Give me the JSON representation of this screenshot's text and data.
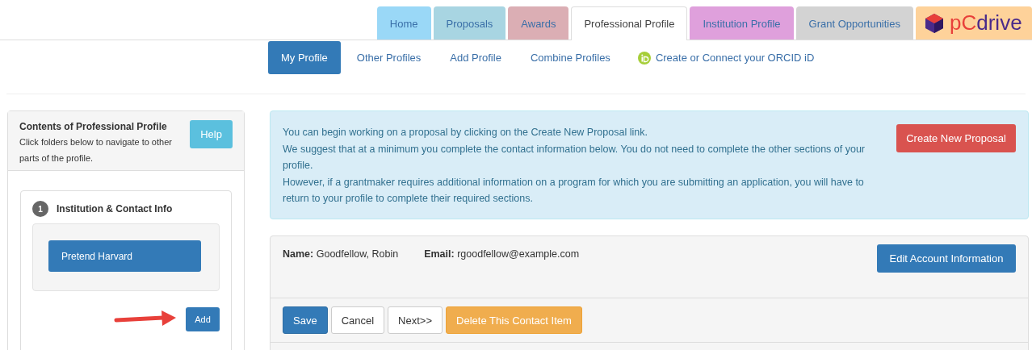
{
  "tabs": [
    {
      "label": "Home",
      "selected": false,
      "color": "#9ad8f7"
    },
    {
      "label": "Proposals",
      "selected": false,
      "color": "#a8d5e2"
    },
    {
      "label": "Awards",
      "selected": false,
      "color": "#dbaeb4"
    },
    {
      "label": "Professional Profile",
      "selected": true,
      "color": "#ffffff"
    },
    {
      "label": "Institution Profile",
      "selected": false,
      "color": "#dfa0dc"
    },
    {
      "label": "Grant Opportunities",
      "selected": false,
      "color": "#d3d3d3"
    }
  ],
  "brand": {
    "text_start": "pC",
    "text_end": "drive"
  },
  "subnav": [
    {
      "label": "My Profile",
      "selected": true
    },
    {
      "label": "Other Profiles",
      "selected": false
    },
    {
      "label": "Add Profile",
      "selected": false
    },
    {
      "label": "Combine Profiles",
      "selected": false
    }
  ],
  "orcid_link": "Create or Connect your ORCID iD",
  "sidebar": {
    "title": "Contents of Professional Profile",
    "subtitle": "Click folders below to navigate to other parts of the profile.",
    "help_button": "Help",
    "section": {
      "number": "1",
      "title": "Institution & Contact Info",
      "items": [
        "Pretend Harvard"
      ],
      "add_button": "Add"
    }
  },
  "notice": {
    "lines": [
      "You can begin working on a proposal by clicking on the Create New Proposal link.",
      "We suggest that at a minimum you complete the contact information below. You do not need to complete the other sections of your profile.",
      "However, if a grantmaker requires additional information on a program for which you are submitting an application, you will have to return to your profile to complete their required sections."
    ],
    "button": "Create New Proposal"
  },
  "account": {
    "name_label": "Name:",
    "name": "Goodfellow, Robin",
    "email_label": "Email:",
    "email": "rgoodfellow@example.com",
    "button": "Edit Account Information"
  },
  "actions": [
    {
      "label": "Save",
      "kind": "primary"
    },
    {
      "label": "Cancel",
      "kind": "default"
    },
    {
      "label": "Next>>",
      "kind": "default"
    },
    {
      "label": "Delete This Contact Item",
      "kind": "warning"
    }
  ]
}
